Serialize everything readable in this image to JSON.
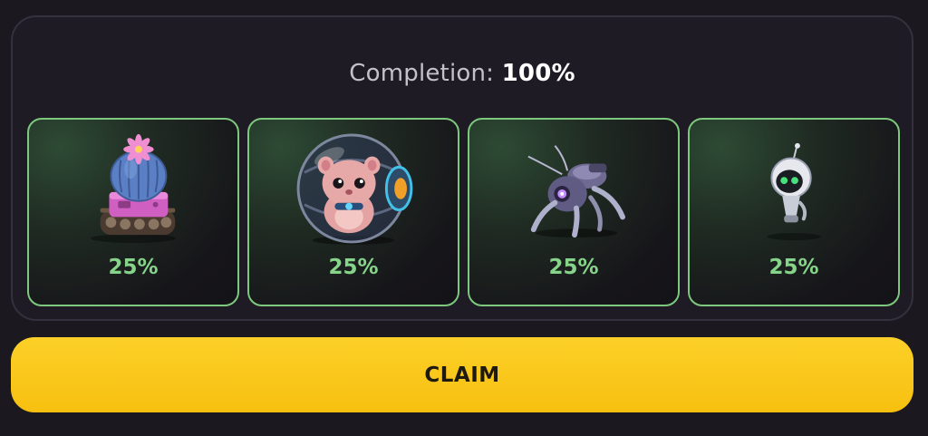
{
  "completion": {
    "label": "Completion:",
    "value": "100%"
  },
  "cards": [
    {
      "name": "cactus-tank",
      "percent": "25%",
      "icon": "cactus-tank-icon"
    },
    {
      "name": "hamster-ball",
      "percent": "25%",
      "icon": "hamster-ball-icon"
    },
    {
      "name": "spider-bot",
      "percent": "25%",
      "icon": "spider-bot-icon"
    },
    {
      "name": "robot-drone",
      "percent": "25%",
      "icon": "robot-drone-icon"
    }
  ],
  "claim": {
    "label": "CLAIM"
  },
  "colors": {
    "accent_green": "#86d48a",
    "card_border": "#7dc87e",
    "claim_yellow": "#f9c51a",
    "background": "#1b1820"
  }
}
